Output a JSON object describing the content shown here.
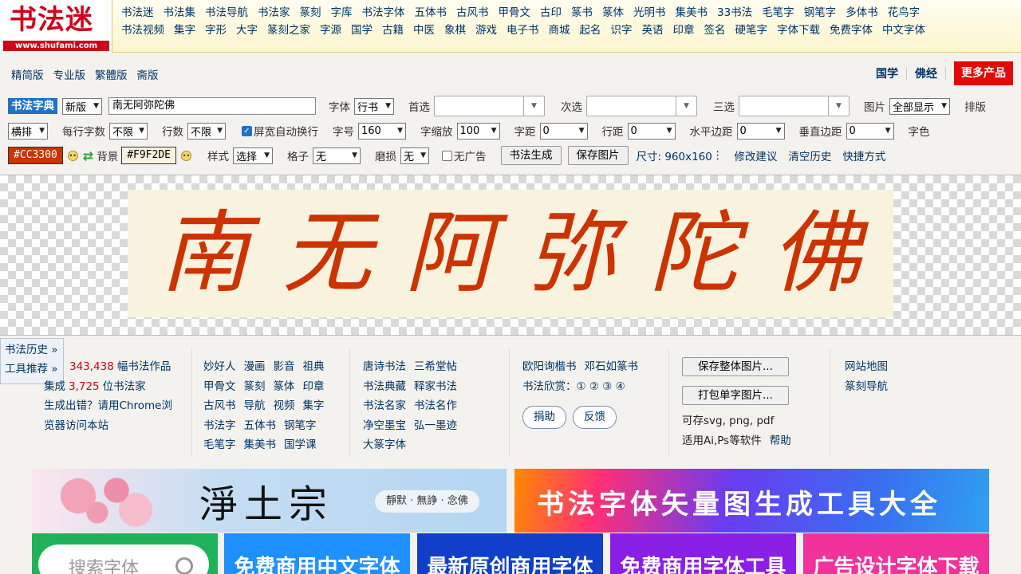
{
  "logo": {
    "text": "书法迷",
    "url": "www.shufami.com"
  },
  "nav_row1": [
    "书法迷",
    "书法集",
    "书法导航",
    "书法家",
    "篆刻",
    "字库",
    "书法字体",
    "五体书",
    "古风书",
    "甲骨文",
    "古印",
    "篆书",
    "篆体",
    "光明书",
    "集美书",
    "33书法",
    "毛笔字",
    "钢笔字",
    "多体书",
    "花鸟字"
  ],
  "nav_row2": [
    "书法视频",
    "集字",
    "字形",
    "大字",
    "篆刻之家",
    "字源",
    "国学",
    "古籍",
    "中医",
    "象棋",
    "游戏",
    "电子书",
    "商城",
    "起名",
    "识字",
    "英语",
    "印章",
    "签名",
    "硬笔字",
    "字体下载",
    "免费字体",
    "中文字体"
  ],
  "versions": [
    "精简版",
    "专业版",
    "繁體版",
    "斋版"
  ],
  "top_right": {
    "guoxue": "国学",
    "fojing": "佛经",
    "more": "更多产品"
  },
  "toolbar": {
    "dict": "书法字典",
    "version_select": "新版",
    "text_value": "南无阿弥陀佛",
    "font_label": "字体",
    "font_value": "行书",
    "first_label": "首选",
    "second_label": "次选",
    "third_label": "三选",
    "image_label": "图片",
    "image_value": "全部显示",
    "layout_label": "排版",
    "layout_value": "横排",
    "per_line_label": "每行字数",
    "per_line_value": "不限",
    "lines_label": "行数",
    "lines_value": "不限",
    "autowrap_label": "屏宽自动换行",
    "size_label": "字号",
    "size_value": "160",
    "scale_label": "字缩放",
    "scale_value": "100",
    "spacing_label": "字距",
    "spacing_value": "0",
    "linespacing_label": "行距",
    "linespacing_value": "0",
    "hmargin_label": "水平边距",
    "hmargin_value": "0",
    "vmargin_label": "垂直边距",
    "vmargin_value": "0",
    "color_label": "字色",
    "color_value": "#CC3300",
    "bg_label": "背景",
    "bg_value": "#F9F2DE",
    "style_label": "样式",
    "style_value": "选择",
    "grid_label": "格子",
    "grid_value": "无",
    "wear_label": "磨损",
    "wear_value": "无",
    "noad_label": "无广告",
    "generate": "书法生成",
    "save": "保存图片",
    "size_info": "尺寸: 960x160",
    "suggest": "修改建议",
    "clear": "清空历史",
    "shortcut": "快捷方式"
  },
  "artwork": {
    "chars": [
      "南",
      "无",
      "阿",
      "弥",
      "陀",
      "佛"
    ]
  },
  "side": {
    "history": "书法历史 »",
    "tools": "工具推荐 »"
  },
  "stats": {
    "works_count": "343,438",
    "works_suffix": "幅书法作品",
    "artists_prefix": "集成",
    "artists_count": "3,725",
    "artists_suffix": "位书法家",
    "error_tip1": "生成出错？请用Chrome浏",
    "error_tip2": "览器访问本站"
  },
  "col2": [
    [
      "妙好人",
      "漫画",
      "影音",
      "祖典"
    ],
    [
      "甲骨文",
      "篆刻",
      "篆体",
      "印章"
    ],
    [
      "古风书",
      "导航",
      "视频",
      "集字"
    ],
    [
      "书法字",
      "五体书",
      "钢笔字"
    ],
    [
      "毛笔字",
      "集美书",
      "国学课"
    ]
  ],
  "col3": [
    [
      "唐诗书法",
      "三希堂帖"
    ],
    [
      "书法典藏",
      "释家书法"
    ],
    [
      "书法名家",
      "书法名作"
    ],
    [
      "净空墨宝",
      "弘一墨迹"
    ],
    [
      "大篆字体"
    ]
  ],
  "col4": {
    "row1": [
      "欧阳询楷书",
      "邓石如篆书"
    ],
    "appreciate": "书法欣赏：① ② ③ ④",
    "donate": "捐助",
    "feedback": "反馈"
  },
  "col5": {
    "save_all": "保存整体图片...",
    "pack": "打包单字图片...",
    "formats": "可存svg, png, pdf",
    "apps": "适用Ai,Ps等软件",
    "help": "帮助"
  },
  "col6": [
    "网站地图",
    "篆刻导航"
  ],
  "banners": {
    "b1_title": "淨土宗",
    "b1_sub": "靜默 · 無諍 · 念佛",
    "b2_title": "书法字体矢量图生成工具大全",
    "search_placeholder": "搜索字体",
    "s2": "免费商用中文字体",
    "s3": "最新原创商用字体",
    "s4": "免费商用字体工具",
    "s5": "广告设计字体下载"
  },
  "colors": {
    "brand_red": "#d0041a",
    "link": "#003366",
    "accent_blue": "#1f72c8",
    "ink": "#CC3300",
    "paper": "#F9F2DE"
  }
}
